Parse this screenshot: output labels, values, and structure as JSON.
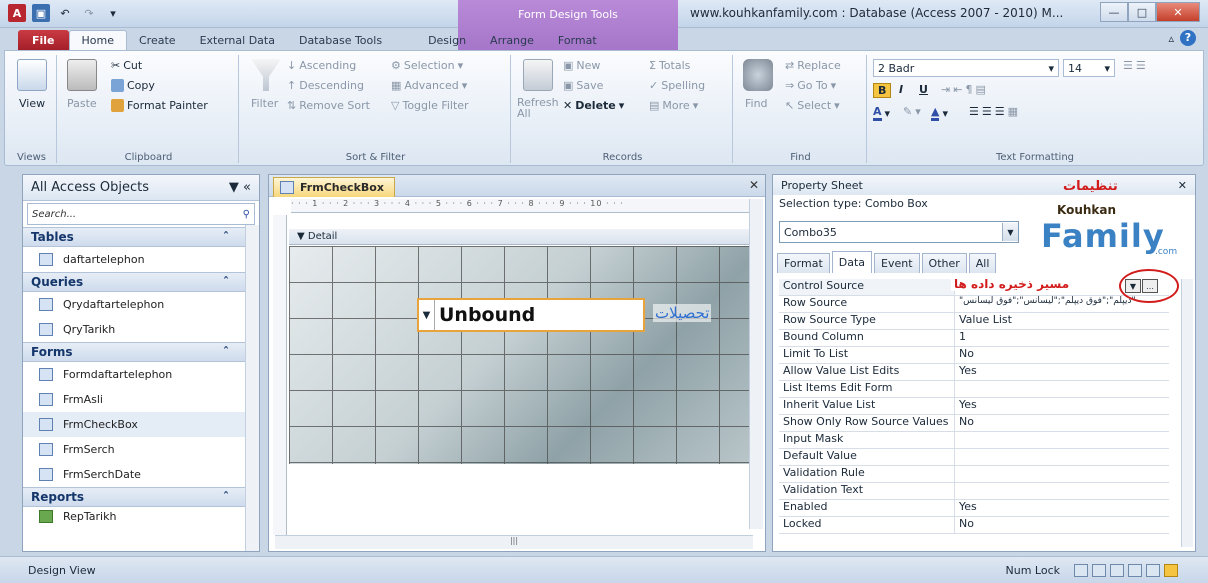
{
  "title": {
    "window": "www.kouhkanfamily.com : Database (Access 2007 - 2010) M...",
    "contextual": "Form Design Tools"
  },
  "ribbon_tabs": [
    "File",
    "Home",
    "Create",
    "External Data",
    "Database Tools",
    "Design",
    "Arrange",
    "Format"
  ],
  "ribbon": {
    "views": {
      "label": "View",
      "group": "Views"
    },
    "clipboard": {
      "paste": "Paste",
      "cut": "Cut",
      "copy": "Copy",
      "format_painter": "Format Painter",
      "group": "Clipboard"
    },
    "sort_filter": {
      "filter": "Filter",
      "ascending": "Ascending",
      "descending": "Descending",
      "remove_sort": "Remove Sort",
      "selection": "Selection",
      "advanced": "Advanced",
      "toggle_filter": "Toggle Filter",
      "group": "Sort & Filter"
    },
    "records": {
      "refresh": "Refresh All",
      "new": "New",
      "save": "Save",
      "delete": "Delete",
      "totals": "Totals",
      "spelling": "Spelling",
      "more": "More",
      "group": "Records"
    },
    "find": {
      "find": "Find",
      "replace": "Replace",
      "goto": "Go To",
      "select": "Select",
      "group": "Find"
    },
    "text": {
      "font": "2 Badr",
      "size": "14",
      "bold": "B",
      "italic": "I",
      "underline": "U",
      "group": "Text Formatting"
    }
  },
  "nav": {
    "header": "All Access Objects",
    "search_placeholder": "Search...",
    "tables_label": "Tables",
    "tables": [
      "daftartelephon"
    ],
    "queries_label": "Queries",
    "queries": [
      "Qrydaftartelephon",
      "QryTarikh"
    ],
    "forms_label": "Forms",
    "forms": [
      "Formdaftartelephon",
      "FrmAsli",
      "FrmCheckBox",
      "FrmSerch",
      "FrmSerchDate"
    ],
    "reports_label": "Reports",
    "reports": [
      "RepTarikh"
    ]
  },
  "document": {
    "tab": "FrmCheckBox",
    "detail": "Detail",
    "ruler": "· · · 1 · · · 2 · · · 3 · · · 4 · · · 5 · · · 6 · · · 7 · · · 8 · · · 9 · · · 10 · · ·",
    "combo_text": "Unbound",
    "combo_label": "تحصیلات"
  },
  "props": {
    "title": "Property Sheet",
    "selection_type": "Selection type:  Combo Box",
    "selected_control": "Combo35",
    "tabs": [
      "Format",
      "Data",
      "Event",
      "Other",
      "All"
    ],
    "active_tab": "Data",
    "annotation_title": "تنظیمات",
    "annotation_source": "مسیر ذخیره داده ها",
    "logo_top": "Kouhkan",
    "logo_main": "Family",
    "logo_com": ".com",
    "rows": [
      {
        "name": "Control Source",
        "value": ""
      },
      {
        "name": "Row Source",
        "value": "\"دیپلم\";\"فوق دیپلم\";\"لیسانس\";\"فوق لیسانس\""
      },
      {
        "name": "Row Source Type",
        "value": "Value List"
      },
      {
        "name": "Bound Column",
        "value": "1"
      },
      {
        "name": "Limit To List",
        "value": "No"
      },
      {
        "name": "Allow Value List Edits",
        "value": "Yes"
      },
      {
        "name": "List Items Edit Form",
        "value": ""
      },
      {
        "name": "Inherit Value List",
        "value": "Yes"
      },
      {
        "name": "Show Only Row Source Values",
        "value": "No"
      },
      {
        "name": "Input Mask",
        "value": ""
      },
      {
        "name": "Default Value",
        "value": ""
      },
      {
        "name": "Validation Rule",
        "value": ""
      },
      {
        "name": "Validation Text",
        "value": ""
      },
      {
        "name": "Enabled",
        "value": "Yes"
      },
      {
        "name": "Locked",
        "value": "No"
      }
    ]
  },
  "status": {
    "left": "Design View",
    "numlock": "Num Lock"
  }
}
